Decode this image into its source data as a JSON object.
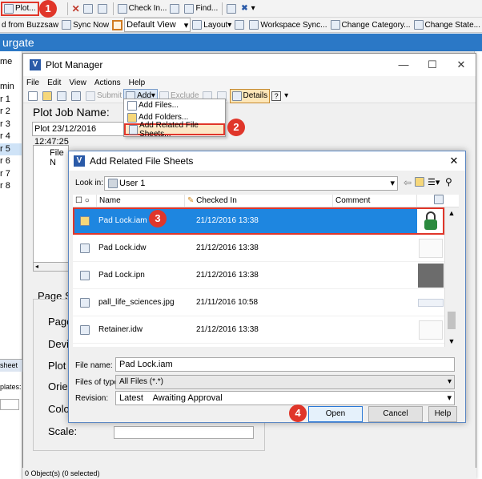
{
  "toolbar1": {
    "plot": "Plot...",
    "check_in": "Check In...",
    "find": "Find..."
  },
  "toolbar2": {
    "buzzsaw": "d from Buzzsaw",
    "sync_now": "Sync Now",
    "view_select": "Default View",
    "layout": "Layout",
    "workspace_sync": "Workspace Sync...",
    "change_category": "Change Category...",
    "change_state": "Change State..."
  },
  "blue_bar": {
    "text": "urgate"
  },
  "left_pane": [
    "me",
    "",
    "min",
    "r 1",
    "r 2",
    "r 3",
    "r 4",
    "r 5",
    "r 6",
    "r 7",
    "r 8"
  ],
  "left_pane_bottom": {
    "sheet": "sheet",
    "plates": "plates:"
  },
  "plot_manager": {
    "title": "Plot Manager",
    "menu": [
      "File",
      "Edit",
      "View",
      "Actions",
      "Help"
    ],
    "tools": {
      "submit": "Submit",
      "add": "Add",
      "exclude": "Exclude",
      "details": "Details"
    },
    "job_name_label": "Plot Job Name:",
    "job_name_value": "Plot 23/12/2016 12:47:25",
    "file_col_partial": "File N",
    "page_setup_partial": "Page S",
    "side_labels": [
      "Page",
      "Devic",
      "Plot",
      "Orien",
      "Colo",
      "Scale:"
    ],
    "status": "0 Object(s) (0 selected)"
  },
  "add_menu": {
    "items": [
      "Add Files...",
      "Add Folders...",
      "Add Related File Sheets..."
    ]
  },
  "dialog": {
    "title": "Add Related File Sheets",
    "look_in_label": "Look in:",
    "look_in_value": "User 1",
    "columns": {
      "name": "Name",
      "checked_in": "Checked In",
      "comment": "Comment"
    },
    "files": [
      {
        "name": "Pad Lock.iam",
        "checked_in": "21/12/2016 13:38",
        "selected": true
      },
      {
        "name": "Pad Lock.idw",
        "checked_in": "21/12/2016 13:38",
        "selected": false
      },
      {
        "name": "Pad Lock.ipn",
        "checked_in": "21/12/2016 13:38",
        "selected": false
      },
      {
        "name": "pall_life_sciences.jpg",
        "checked_in": "21/11/2016 10:58",
        "selected": false
      },
      {
        "name": "Retainer.idw",
        "checked_in": "21/12/2016 13:38",
        "selected": false
      }
    ],
    "file_name_label": "File name:",
    "file_name_value": "Pad Lock.iam",
    "files_of_type_label": "Files of type:",
    "files_of_type_value": "All Files (*.*)",
    "revision_label": "Revision:",
    "revision_value": "Latest    Awaiting Approval",
    "buttons": {
      "open": "Open",
      "cancel": "Cancel",
      "help": "Help"
    }
  },
  "badges": [
    "1",
    "2",
    "3",
    "4"
  ],
  "colors": {
    "accent": "#2b78c6",
    "callout": "#e0362a",
    "selection": "#1e86e0"
  }
}
